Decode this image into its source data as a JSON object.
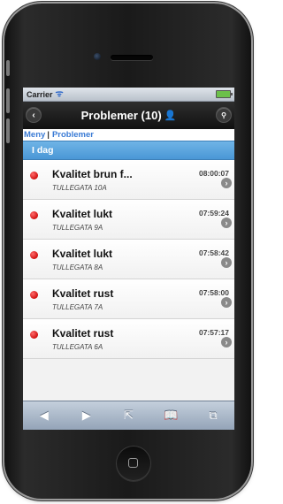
{
  "statusbar": {
    "carrier": "Carrier",
    "wifi_icon": "wifi-icon",
    "battery_icon": "battery-icon"
  },
  "header": {
    "title": "Problemer (10)",
    "back_icon": "back-icon",
    "user_icon": "user-icon",
    "search_icon": "search-icon"
  },
  "breadcrumb": {
    "items": [
      "Meny",
      "Problemer"
    ],
    "separator": "|"
  },
  "section": {
    "title": "I dag"
  },
  "items": [
    {
      "title": "Kvalitet brun f...",
      "address": "TULLEGATA 10A",
      "time": "08:00:07"
    },
    {
      "title": "Kvalitet lukt",
      "address": "TULLEGATA 9A",
      "time": "07:59:24"
    },
    {
      "title": "Kvalitet lukt",
      "address": "TULLEGATA 8A",
      "time": "07:58:42"
    },
    {
      "title": "Kvalitet rust",
      "address": "TULLEGATA 7A",
      "time": "07:58:00"
    },
    {
      "title": "Kvalitet rust",
      "address": "TULLEGATA 6A",
      "time": "07:57:17"
    }
  ],
  "toolbar": {
    "icons": [
      "back-arrow-icon",
      "forward-arrow-icon",
      "share-icon",
      "bookmarks-icon",
      "tabs-icon"
    ]
  },
  "colors": {
    "section_blue": "#4a97d6",
    "status_red": "#d01010",
    "link_blue": "#3a7bd5"
  }
}
